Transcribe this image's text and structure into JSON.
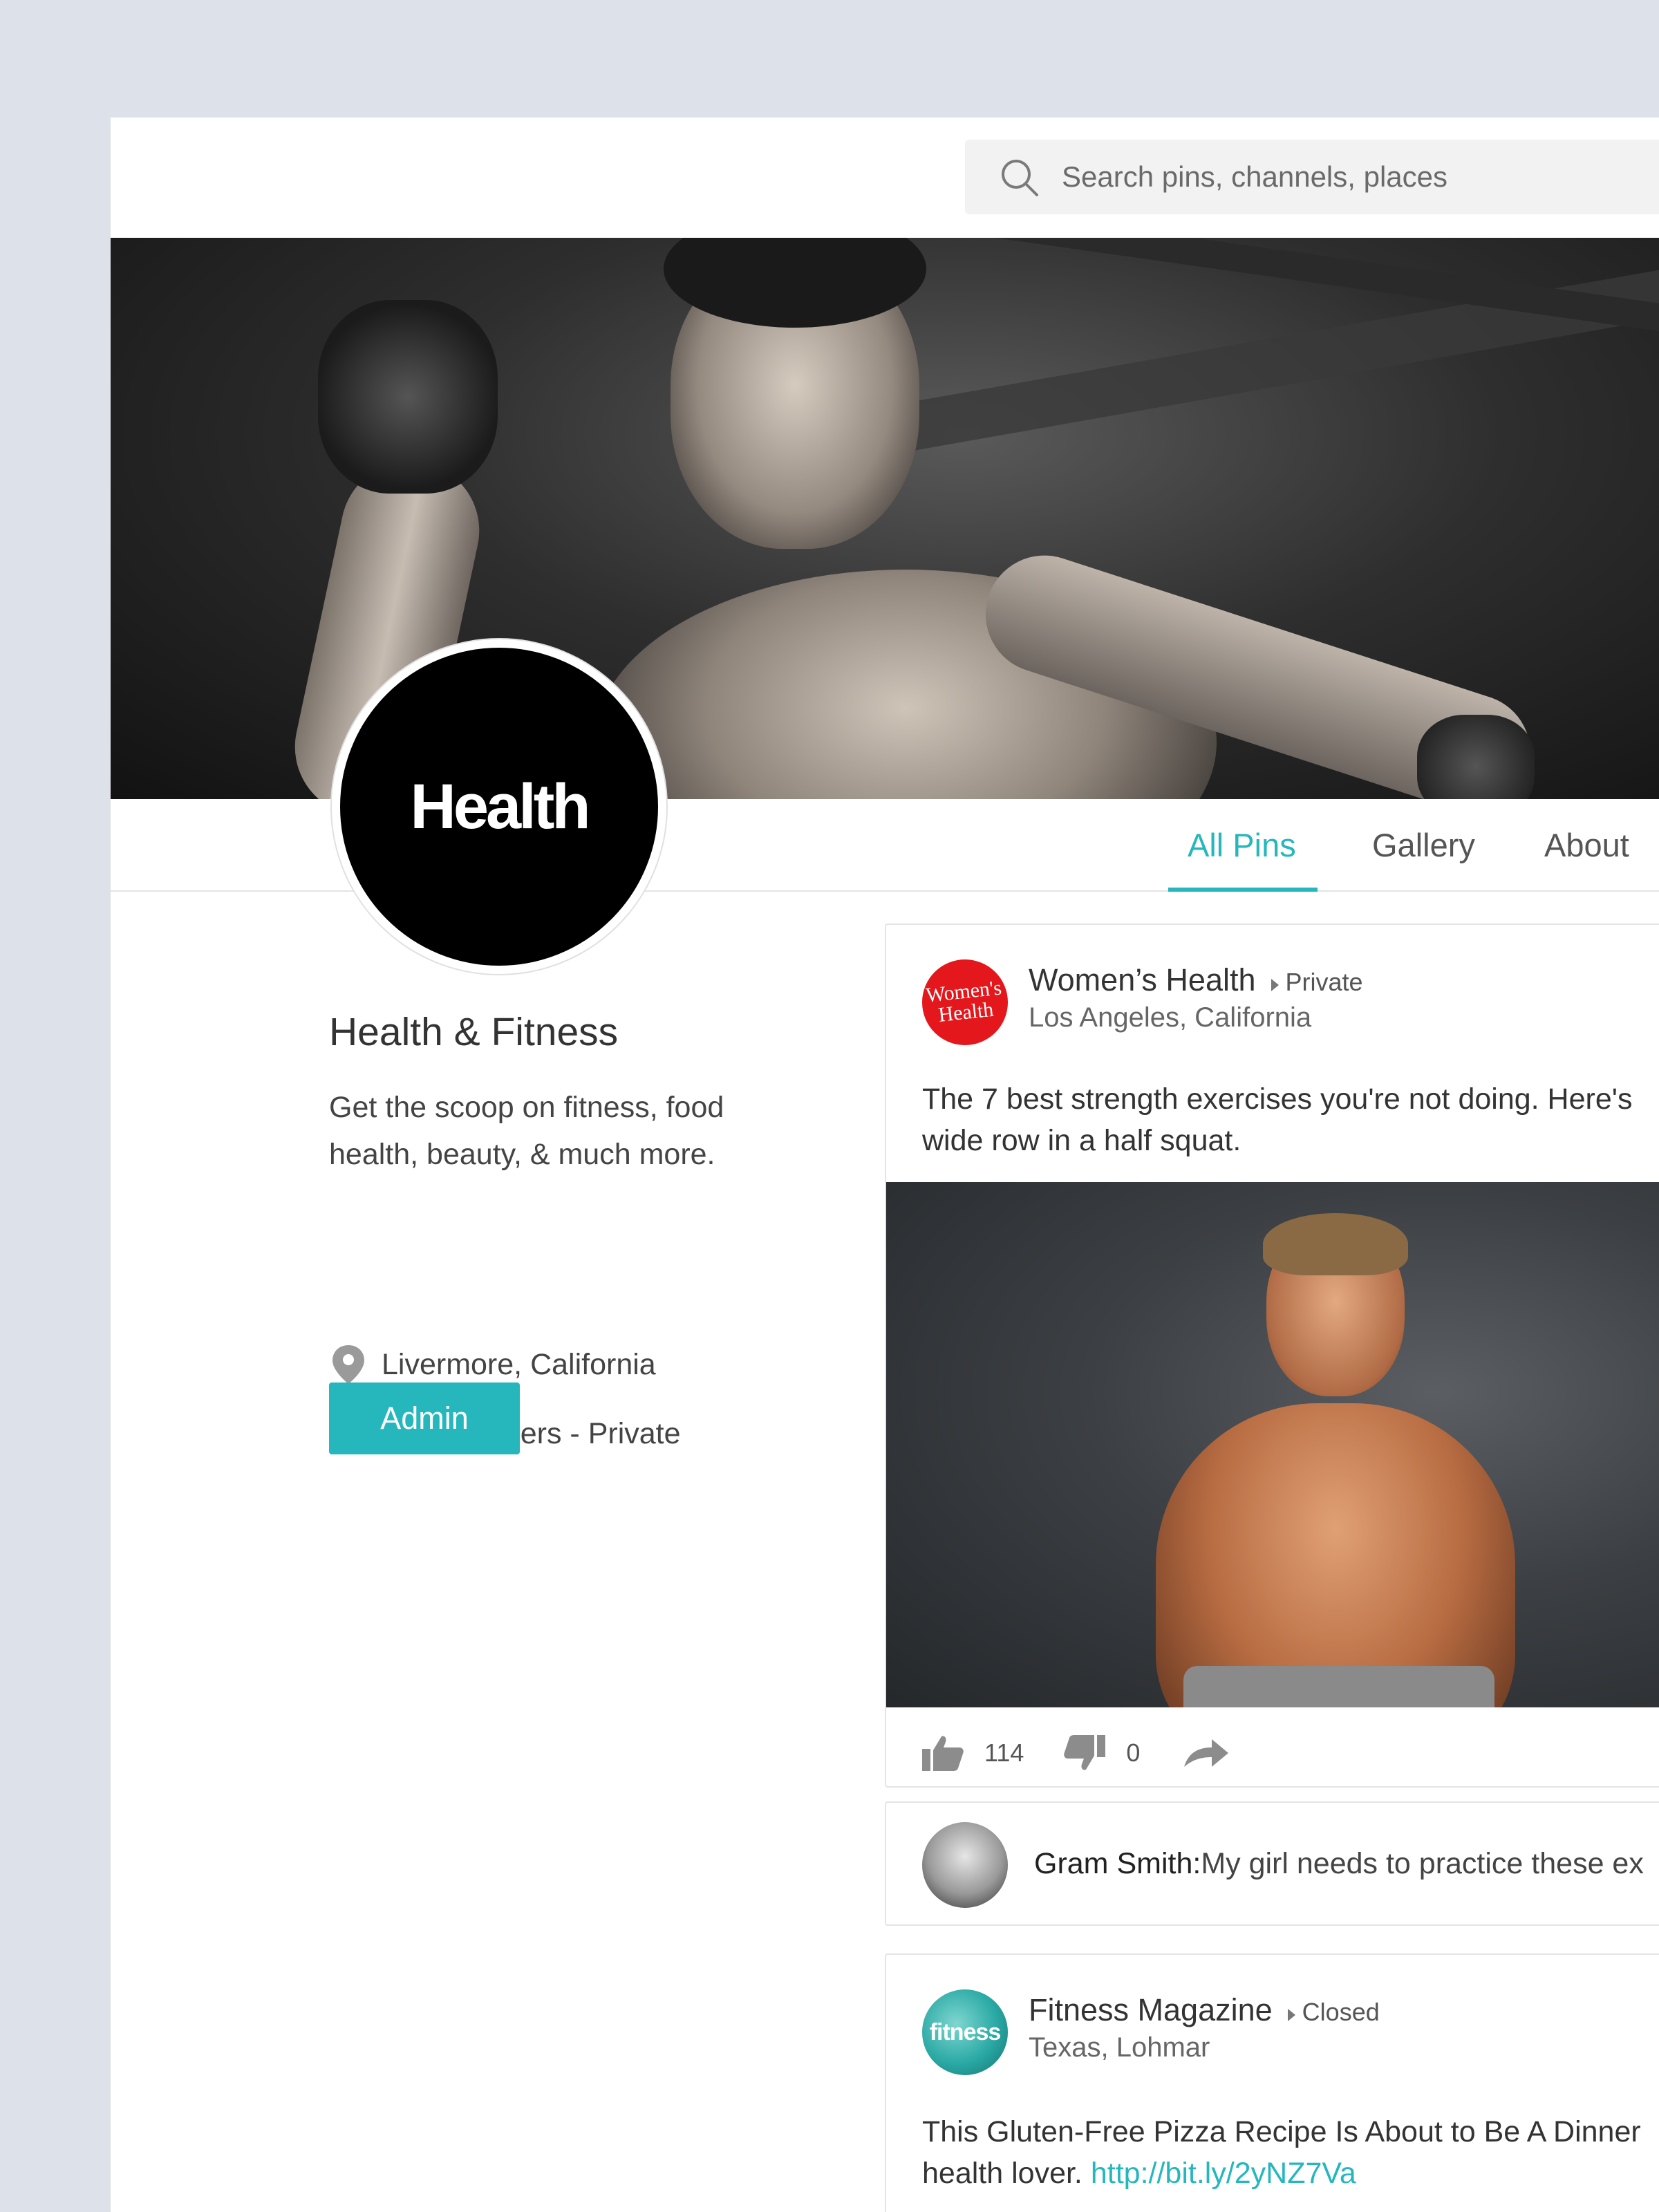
{
  "search": {
    "placeholder": "Search pins, channels, places"
  },
  "tabs": [
    {
      "label": "All Pins",
      "active": true
    },
    {
      "label": "Gallery",
      "active": false
    },
    {
      "label": "About",
      "active": false
    }
  ],
  "group": {
    "avatar_text": "Health",
    "title": "Health & Fitness",
    "description": "Get the scoop on fitness, food health, beauty, & much more.",
    "location": "Livermore, California",
    "members": "16k Members - Private",
    "admin_label": "Admin"
  },
  "posts": [
    {
      "logo_text_line1": "Women's",
      "logo_text_line2": "Health",
      "source": "Women’s Health",
      "privacy": "Private",
      "location": "Los Angeles, California",
      "text": "The 7 best strength exercises you're not doing. Here's wide row in a half squat.",
      "likes": "114",
      "dislikes": "0",
      "comment": {
        "author": "Gram Smith:",
        "text": "My girl needs to practice these ex"
      }
    },
    {
      "logo_text": "fitness",
      "source": "Fitness Magazine",
      "privacy": "Closed",
      "location": "Texas, Lohmar",
      "text": "This Gluten-Free Pizza Recipe Is About to Be A Dinner health lover.",
      "link": "http://bit.ly/2yNZ7Va"
    }
  ],
  "colors": {
    "accent": "#26b7bd",
    "page_background": "#dde1e9",
    "womens_health_red": "#e3171c",
    "fitness_teal": "#2aa9a5"
  },
  "icons": [
    "search-icon",
    "location-pin-icon",
    "user-icon",
    "thumbs-up-icon",
    "thumbs-down-icon",
    "share-icon"
  ]
}
